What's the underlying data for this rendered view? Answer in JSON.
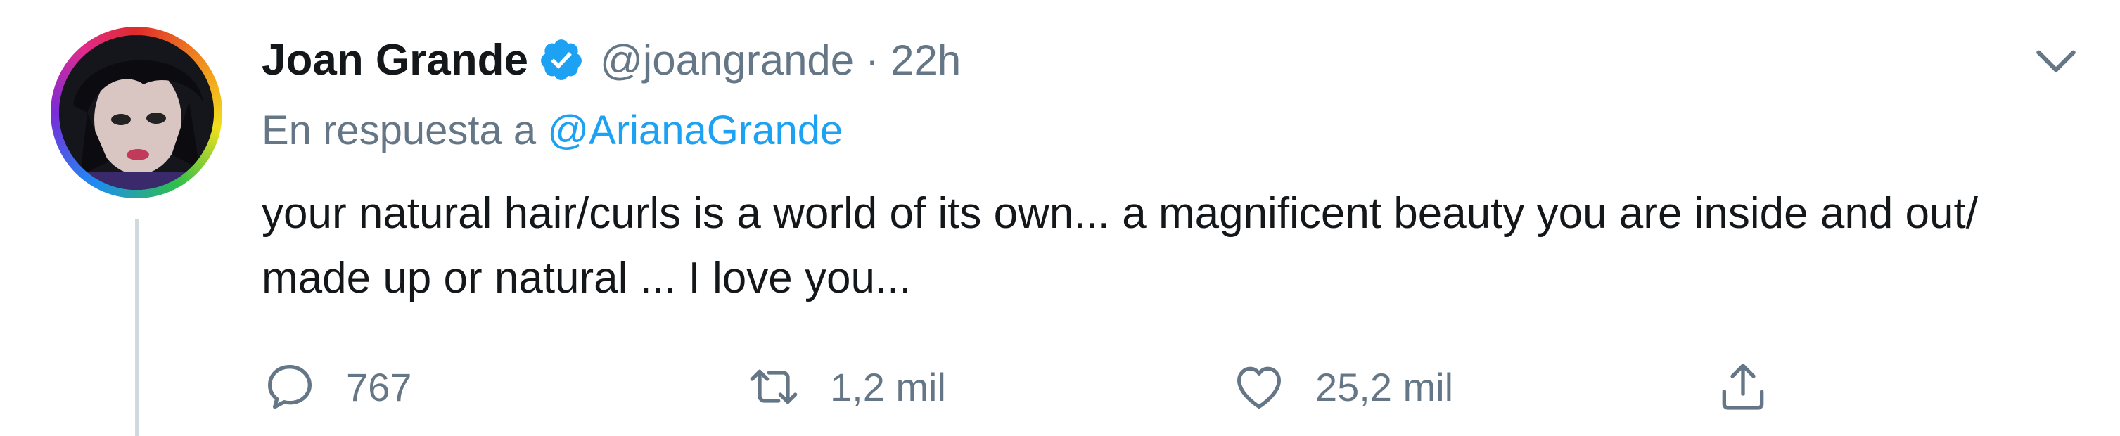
{
  "tweet": {
    "author": {
      "name": "Joan Grande",
      "handle": "@joangrande",
      "verified": true,
      "avatar": "avatar"
    },
    "separator": "·",
    "time": "22h",
    "reply_prefix": "En respuesta a",
    "reply_to": "@ArianaGrande",
    "text": "your natural hair/curls is a world of its own... a magnificent beauty you are inside and out/ made up or natural ... I love you...",
    "actions": {
      "reply_count": "767",
      "retweet_count": "1,2 mil",
      "like_count": "25,2 mil"
    }
  },
  "colors": {
    "text": "#14171a",
    "secondary": "#657786",
    "link": "#1da1f2",
    "verified": "#1da1f2"
  },
  "icons": [
    "chevron-down-icon",
    "verified-badge-icon",
    "reply-icon",
    "retweet-icon",
    "like-icon",
    "share-icon"
  ]
}
